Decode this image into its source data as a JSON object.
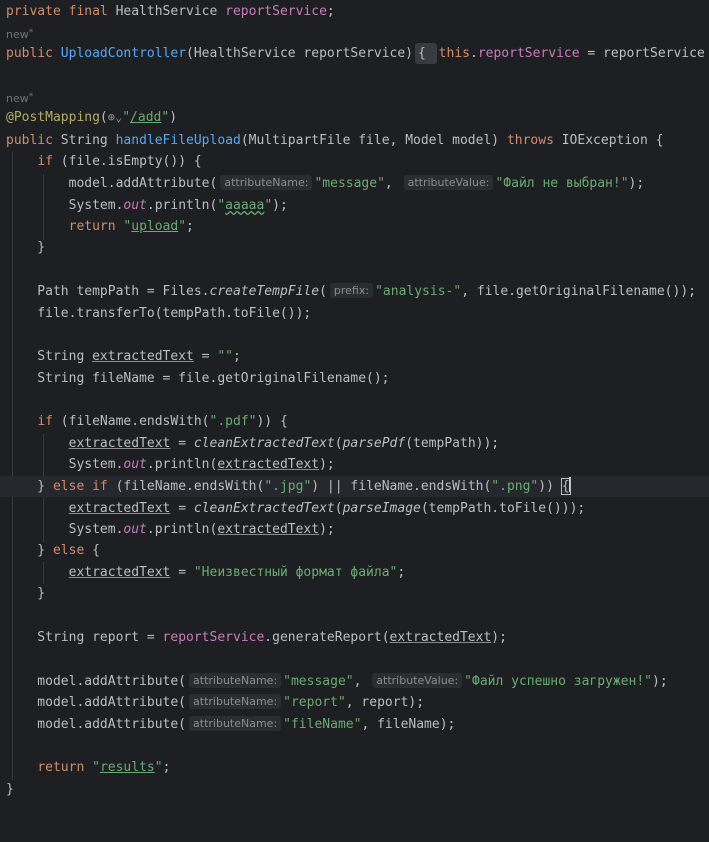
{
  "editor": {
    "colors": {
      "background": "#1e1f22",
      "keyword": "#cf8e6d",
      "field": "#c77dbb",
      "method": "#56a8f5",
      "string": "#6aab73",
      "annotation": "#b3ae60",
      "text": "#bcbec4",
      "hint": "#8a8d93"
    },
    "new_label": "new",
    "new_icon": "*",
    "globe_icon": "⊕",
    "chevron_icon": "⌄",
    "hint_attributeName": "attributeName:",
    "hint_attributeValue": "attributeValue:",
    "hint_prefix": "prefix:",
    "l1": {
      "a": "private final ",
      "b": "HealthService ",
      "c": "reportService",
      "d": ";"
    },
    "l2": {
      "a": "public ",
      "b": "UploadController",
      "c": "(HealthService reportService)",
      "d": "{ ",
      "e": "this",
      "f": ".",
      "g": "reportService",
      "h": " = reportService"
    },
    "l3": {
      "a": "@PostMapping",
      "b": "(",
      "c": "\"",
      "d": "/add",
      "e": "\"",
      "f": ")"
    },
    "l4": {
      "a": "public ",
      "b": "String ",
      "c": "handleFileUpload",
      "d": "(MultipartFile file, Model model) ",
      "e": "throws ",
      "f": "IOException {"
    },
    "l5": {
      "a": "    ",
      "b": "if ",
      "c": "(file.isEmpty()) {"
    },
    "l6": {
      "a": "        model.addAttribute(",
      "b": "\"message\"",
      "c": ", ",
      "d": "\"Файл не выбран!\"",
      "e": ");"
    },
    "l7": {
      "a": "        System.",
      "b": "out",
      "c": ".println(",
      "d": "\"",
      "e": "aaaaa",
      "f": "\"",
      "g": ");"
    },
    "l8": {
      "a": "        ",
      "b": "return ",
      "c": "\"",
      "d": "upload",
      "e": "\"",
      "f": ";"
    },
    "l9": {
      "a": "    }"
    },
    "l10": {
      "a": "    Path tempPath = Files.",
      "b": "createTempFile",
      "c": "(",
      "d": "\"analysis-\"",
      "e": ", file.getOriginalFilename());"
    },
    "l11": {
      "a": "    file.transferTo(tempPath.toFile());"
    },
    "l12": {
      "a": "    String ",
      "b": "extractedText",
      "c": " = ",
      "d": "\"\"",
      "e": ";"
    },
    "l13": {
      "a": "    String fileName = file.getOriginalFilename();"
    },
    "l14": {
      "a": "    ",
      "b": "if ",
      "c": "(fileName.endsWith(",
      "d": "\".pdf\"",
      "e": ")) {"
    },
    "l15": {
      "a": "        ",
      "b": "extractedText",
      "c": " = ",
      "d": "cleanExtractedText",
      "e": "(",
      "f": "parsePdf",
      "g": "(tempPath));"
    },
    "l16": {
      "a": "        System.",
      "b": "out",
      "c": ".println(",
      "d": "extractedText",
      "e": ");"
    },
    "l17": {
      "a": "    } ",
      "b": "else if ",
      "c": "(fileName.endsWith(",
      "d": "\".jpg\"",
      "e": ") || fileName.endsWith(",
      "f": "\".png\"",
      "g": ")) ",
      "h": "{"
    },
    "l18": {
      "a": "        ",
      "b": "extractedText",
      "c": " = ",
      "d": "cleanExtractedText",
      "e": "(",
      "f": "parseImage",
      "g": "(tempPath.toFile()));"
    },
    "l19": {
      "a": "        System.",
      "b": "out",
      "c": ".println(",
      "d": "extractedText",
      "e": ");"
    },
    "l20": {
      "a": "    } ",
      "b": "else ",
      "c": "{"
    },
    "l21": {
      "a": "        ",
      "b": "extractedText",
      "c": " = ",
      "d": "\"Неизвестный формат файла\"",
      "e": ";"
    },
    "l22": {
      "a": "    }"
    },
    "l23": {
      "a": "    String report = ",
      "b": "reportService",
      "c": ".generateReport(",
      "d": "extractedText",
      "e": ");"
    },
    "l24": {
      "a": "    model.addAttribute(",
      "b": "\"message\"",
      "c": ", ",
      "d": "\"Файл успешно загружен!\"",
      "e": ");"
    },
    "l25": {
      "a": "    model.addAttribute(",
      "b": "\"report\"",
      "c": ", report);"
    },
    "l26": {
      "a": "    model.addAttribute(",
      "b": "\"fileName\"",
      "c": ", fileName);"
    },
    "l27": {
      "a": "    ",
      "b": "return ",
      "c": "\"",
      "d": "results",
      "e": "\"",
      "f": ";"
    },
    "l28": {
      "a": "}"
    }
  }
}
